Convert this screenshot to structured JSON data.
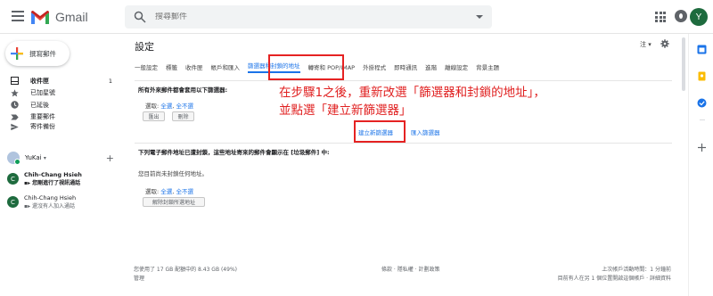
{
  "header": {
    "app_name": "Gmail",
    "search_placeholder": "搜尋郵件",
    "avatar_letter": "Y"
  },
  "sidebar": {
    "compose_label": "撰寫郵件",
    "items": [
      {
        "label": "收件匣",
        "count": "1",
        "bold": true
      },
      {
        "label": "已加星號",
        "count": ""
      },
      {
        "label": "已延後",
        "count": ""
      },
      {
        "label": "重要郵件",
        "count": ""
      },
      {
        "label": "寄件備份",
        "count": ""
      }
    ]
  },
  "hangouts": {
    "user_name": "YuKai",
    "user_caret": "▾",
    "add_label": "+",
    "contacts": [
      {
        "initial": "C",
        "name": "Chih-Chang Hsieh",
        "status": "您剛進行了視訊通話",
        "bold": true
      },
      {
        "initial": "C",
        "name": "Chih-Chang Hsieh",
        "status": "還沒有人加入通話",
        "bold": false
      }
    ]
  },
  "main": {
    "title": "設定",
    "lang_label": "注 ▾",
    "tabs": [
      {
        "label": "一般設定"
      },
      {
        "label": "標籤"
      },
      {
        "label": "收件匣"
      },
      {
        "label": "帳戶和匯入"
      },
      {
        "label": "篩選器和封鎖的地址",
        "active": true
      },
      {
        "label": "轉寄和 POP/IMAP"
      },
      {
        "label": "外掛程式"
      },
      {
        "label": "即時通訊"
      },
      {
        "label": "進階"
      },
      {
        "label": "離線設定"
      },
      {
        "label": "背景主題"
      }
    ],
    "filters_title": "所有外來郵件都會套用以下篩選器:",
    "select_prefix": "選取:",
    "select_all": "全選",
    "select_none": "全不選",
    "export_button": "匯出",
    "delete_button": "刪除",
    "create_filter": "建立新篩選器",
    "import_filter": "匯入篩選器",
    "blocked_title": "下列電子郵件地址已遭封鎖，這些地址寄來的郵件會顯示在 [垃圾郵件] 中:",
    "blocked_empty": "您目前尚未封鎖任何地址。",
    "unblock_button": "解除封鎖所選地址"
  },
  "annotation": {
    "line1": "在步驟1之後，重新改選「篩選器和封鎖的地址」，",
    "line2": "並點選「建立新篩選器」"
  },
  "footer": {
    "storage": "您使用了 17 GB 配額中的 8.43 GB (49%)",
    "manage": "管理",
    "terms": "條款",
    "privacy": "隱私權",
    "policy": "計劃政策",
    "last_activity": "上次帳戶活動時間：1 分鐘前",
    "open_elsewhere": "目前有人在另 1 個位置開啟這個帳戶 · 詳細資料"
  },
  "colors": {
    "accent": "#1a73e8",
    "annotation": "#e02020",
    "gmail_red": "#ea4335"
  }
}
